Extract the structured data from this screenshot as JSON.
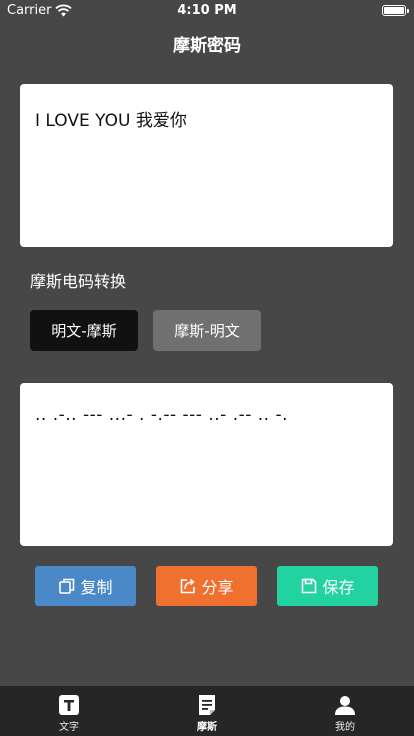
{
  "status": {
    "carrier": "Carrier",
    "time": "4:10 PM"
  },
  "nav": {
    "title": "摩斯密码"
  },
  "input": {
    "text": "I LOVE YOU 我爱你"
  },
  "section": {
    "title": "摩斯电码转换"
  },
  "modes": [
    {
      "label": "明文-摩斯",
      "selected": true
    },
    {
      "label": "摩斯-明文",
      "selected": false
    }
  ],
  "output": {
    "text": ".. .-.. --- ...- . -.-- --- ..- .-- .. -."
  },
  "actions": {
    "copy_label": "复制",
    "share_label": "分享",
    "save_label": "保存"
  },
  "colors": {
    "background": "#474747",
    "copy": "#4a88c7",
    "share": "#f07030",
    "save": "#22d2a0",
    "tabbar": "#262626"
  },
  "tabs": [
    {
      "label": "文字",
      "icon": "text-t-icon",
      "active": false
    },
    {
      "label": "摩斯",
      "icon": "document-icon",
      "active": true
    },
    {
      "label": "我的",
      "icon": "person-icon",
      "active": false
    }
  ]
}
